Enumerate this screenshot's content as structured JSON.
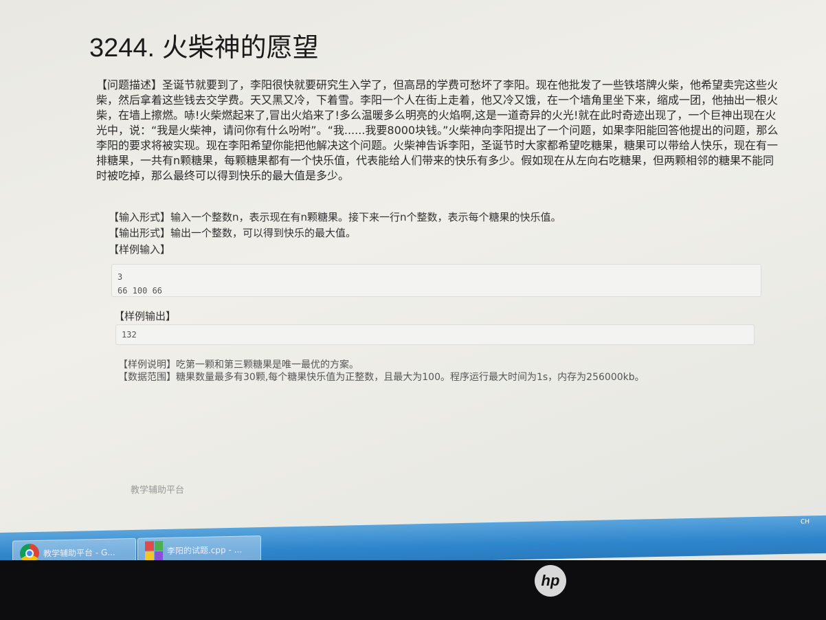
{
  "problem": {
    "title": "3244. 火柴神的愿望",
    "description": "【问题描述】圣诞节就要到了，李阳很快就要研究生入学了，但高昂的学费可愁坏了李阳。现在他批发了一些铁塔牌火柴，他希望卖完这些火柴，然后拿着这些钱去交学费。天又黑又冷，下着雪。李阳一个人在街上走着，他又冷又饿，在一个墙角里坐下来，缩成一团，他抽出一根火柴，在墙上擦燃。哧!火柴燃起来了,冒出火焰来了!多么温暖多么明亮的火焰啊,这是一道奇异的火光!就在此时奇迹出现了，一个巨神出现在火光中，说：“我是火柴神，请问你有什么吩咐”。“我......我要8000块钱。”火柴神向李阳提出了一个问题，如果李阳能回答他提出的问题，那么李阳的要求将被实现。现在李阳希望你能把他解决这个问题。火柴神告诉李阳，圣诞节时大家都希望吃糖果，糖果可以带给人快乐，现在有一排糖果，一共有n颗糖果，每颗糖果都有一个快乐值，代表能给人们带来的快乐有多少。假如现在从左向右吃糖果，但两颗相邻的糖果不能同时被吃掉，那么最终可以得到快乐的最大值是多少。",
    "input_format": "【输入形式】输入一个整数n，表示现在有n颗糖果。接下来一行n个整数，表示每个糖果的快乐值。",
    "output_format": "【输出形式】输出一个整数，可以得到快乐的最大值。",
    "sample_input_label": "【样例输入】",
    "sample_input": "3\n66 100 66",
    "sample_output_label": "【样例输出】",
    "sample_output": "132",
    "sample_explanation": "【样例说明】吃第一颗和第三颗糖果是唯一最优的方案。",
    "data_range": "【数据范围】糖果数量最多有30颗,每个糖果快乐值为正整数，且最大为100。程序运行最大时间为1s，内存为256000kb。"
  },
  "footer": "教学辅助平台",
  "taskbar": {
    "items": [
      {
        "label": "教学辅助平台 - G...",
        "icon": "chrome-icon"
      },
      {
        "label": "李阳的试题.cpp - ...",
        "icon": "ide-icon"
      }
    ],
    "language": "CH"
  },
  "monitor_brand": "hp"
}
